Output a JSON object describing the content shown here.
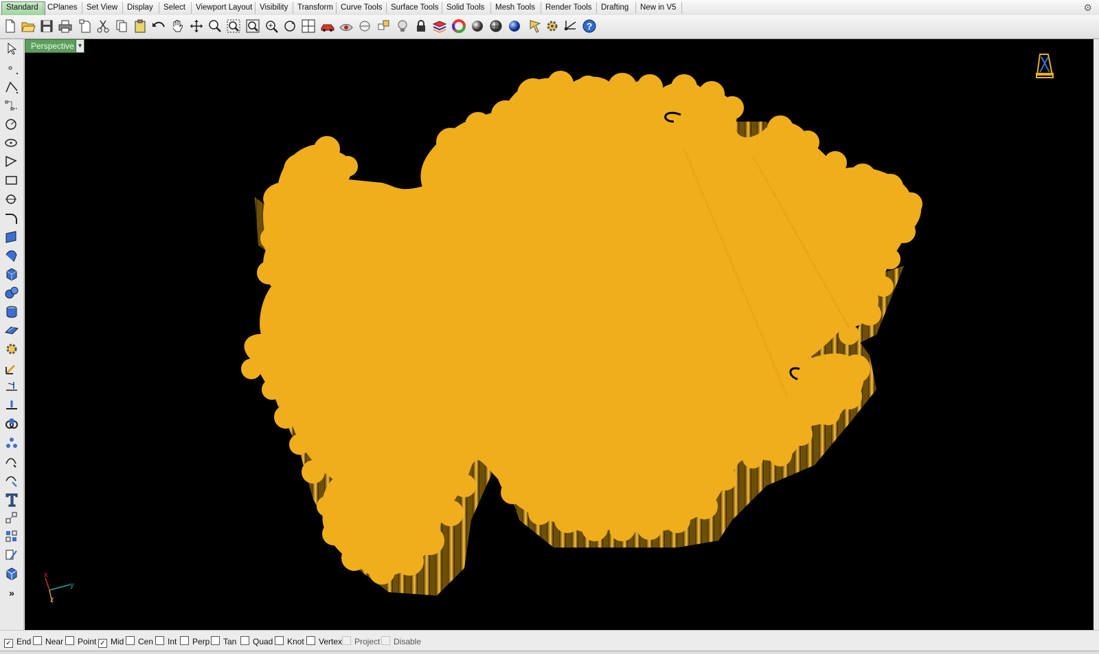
{
  "tabs": [
    "Standard",
    "CPlanes",
    "Set View",
    "Display",
    "Select",
    "Viewport Layout",
    "Visibility",
    "Transform",
    "Curve Tools",
    "Surface Tools",
    "Solid Tools",
    "Mesh Tools",
    "Render Tools",
    "Drafting",
    "New in V5"
  ],
  "toolbar_icons": [
    "new-file-icon",
    "open-folder-icon",
    "save-icon",
    "print-icon",
    "import-icon",
    "cut-icon",
    "copy-icon",
    "paste-icon",
    "undo-icon",
    "pan-hand-icon",
    "move-icon",
    "zoom-window-icon",
    "zoom-extents-icon",
    "zoom-selected-icon",
    "zoom-icon",
    "rotate-view-icon",
    "four-viewports-icon",
    "car-icon",
    "eye-icon",
    "cplane-icon",
    "grid-snap-icon",
    "bulb-icon",
    "lock-icon",
    "layer-icon",
    "color-wheel-icon",
    "shaded-sphere-icon",
    "rendered-sphere-icon",
    "blue-sphere-icon",
    "render-icon",
    "settings-icon",
    "dimension-icon",
    "help-icon"
  ],
  "left_tool_icons": [
    "select-arrow-icon",
    "point-icon",
    "polyline-icon",
    "control-curve-icon",
    "circle-icon",
    "ellipse-icon",
    "polygon-icon",
    "rectangle-icon",
    "arc-icon",
    "fillet-curve-icon",
    "surface-corner-icon",
    "loft-icon",
    "box-icon",
    "spheres-icon",
    "cylinder-icon",
    "plane-surface-icon",
    "gear-tools-icon",
    "transform-arrow-icon",
    "trim-icon",
    "split-icon",
    "boolean-icon",
    "join-icon",
    "offset-icon",
    "explode-icon",
    "text-icon",
    "scale-icon",
    "array-icon",
    "edit-points-icon",
    "cube-icon",
    "more-icon"
  ],
  "viewport": {
    "name": "Perspective",
    "axis_x": "x",
    "axis_y": "y",
    "axis_z": "z",
    "background": "#000000",
    "model_color": "#f0ae1c"
  },
  "osnaps": [
    {
      "label": "End",
      "checked": true
    },
    {
      "label": "Near",
      "checked": false
    },
    {
      "label": "Point",
      "checked": false
    },
    {
      "label": "Mid",
      "checked": true
    },
    {
      "label": "Cen",
      "checked": false
    },
    {
      "label": "Int",
      "checked": false
    },
    {
      "label": "Perp",
      "checked": false
    },
    {
      "label": "Tan",
      "checked": false
    },
    {
      "label": "Quad",
      "checked": false
    },
    {
      "label": "Knot",
      "checked": false
    },
    {
      "label": "Vertex",
      "checked": false
    },
    {
      "label": "Project",
      "checked": false,
      "disabled": true
    },
    {
      "label": "Disable",
      "checked": false,
      "disabled": true
    }
  ]
}
